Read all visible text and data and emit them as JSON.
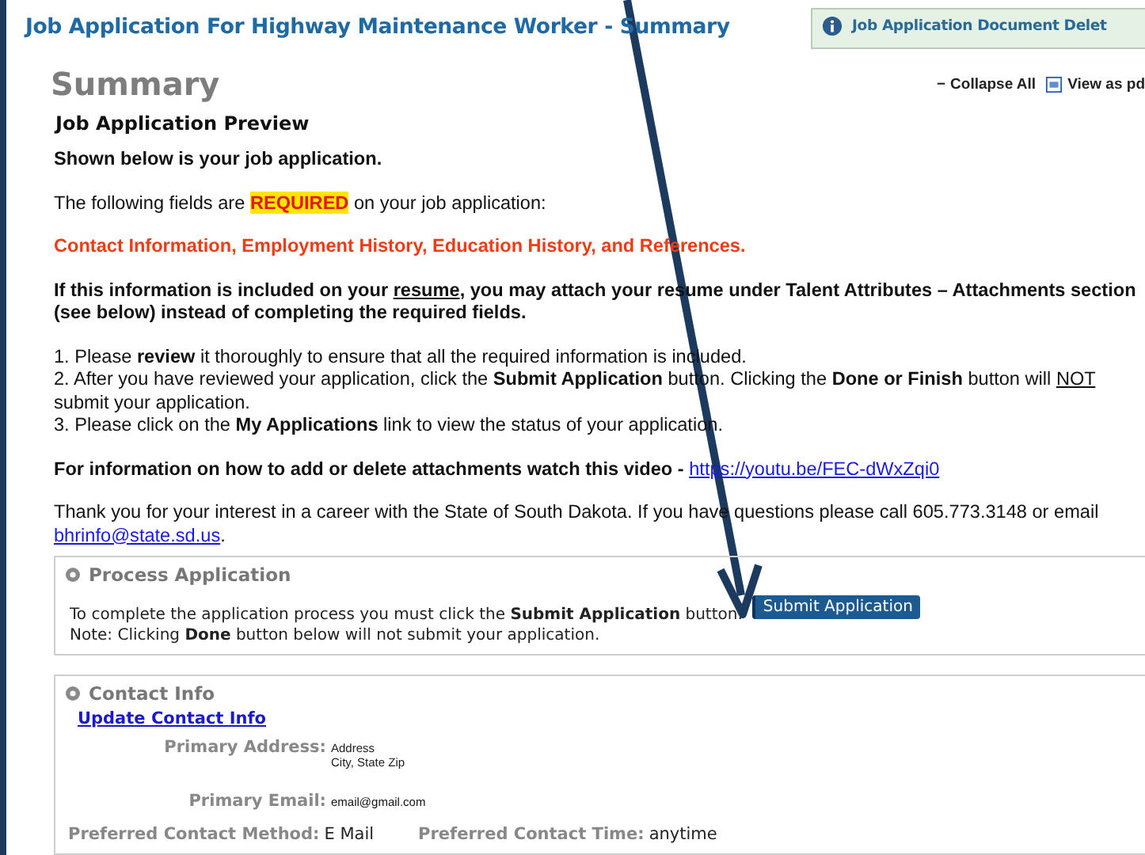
{
  "header": {
    "title": "Job Application For Highway Maintenance Worker - Summary",
    "notice": "Job Application Document Delet"
  },
  "summary": {
    "heading": "Summary",
    "actions": [
      {
        "kind": "collapse",
        "label": "Collapse All",
        "icon": "−"
      },
      {
        "kind": "pdf",
        "label": "View as pd"
      }
    ],
    "subheading": "Job Application Preview"
  },
  "paragraphs": [
    {
      "kind": "bold",
      "lines": [
        [
          {
            "kind": "plain",
            "text": "Shown below is your job application."
          }
        ]
      ]
    },
    {
      "kind": "normal",
      "lines": [
        [
          {
            "kind": "plain",
            "text": "The following fields are "
          },
          {
            "kind": "highlight",
            "text": "REQUIRED"
          },
          {
            "kind": "plain",
            "text": " on your job application:"
          }
        ]
      ]
    },
    {
      "kind": "alert",
      "lines": [
        [
          {
            "kind": "plain",
            "text": "Contact Information, Employment History, Education History, and References."
          }
        ]
      ]
    },
    {
      "kind": "bold",
      "lines": [
        [
          {
            "kind": "plain",
            "text": "If this information is included on your "
          },
          {
            "kind": "underline",
            "text": "resume"
          },
          {
            "kind": "plain",
            "text": ", you may attach your resume under Talent Attributes – Attachments section (see below) instead of completing the required fields."
          }
        ]
      ]
    },
    {
      "kind": "normal",
      "lines": [
        [
          {
            "kind": "plain",
            "text": "1. Please "
          },
          {
            "kind": "bold",
            "text": "review"
          },
          {
            "kind": "plain",
            "text": " it thoroughly to ensure that all the required information is included."
          }
        ],
        [
          {
            "kind": "plain",
            "text": "2. After you have reviewed your application, click the "
          },
          {
            "kind": "bold",
            "text": "Submit Application"
          },
          {
            "kind": "plain",
            "text": " button. Clicking the "
          },
          {
            "kind": "bold",
            "text": "Done or Finish"
          },
          {
            "kind": "plain",
            "text": " button will "
          },
          {
            "kind": "underline",
            "text": "NOT"
          },
          {
            "kind": "plain",
            "text": " submit your application."
          }
        ],
        [
          {
            "kind": "plain",
            "text": "3. Please click on the "
          },
          {
            "kind": "bold",
            "text": "My Applications"
          },
          {
            "kind": "plain",
            "text": " link to view the status of your application."
          }
        ]
      ]
    },
    {
      "kind": "bold",
      "lines": [
        [
          {
            "kind": "plain",
            "text": "For information on how to add or delete attachments watch this video - "
          },
          {
            "kind": "link",
            "text": "https://youtu.be/FEC-dWxZqi0"
          }
        ]
      ]
    },
    {
      "kind": "normal",
      "lines": [
        [
          {
            "kind": "plain",
            "text": "Thank you for your interest in a career with the State of South Dakota. If you have questions please call 605.773.3148 or email "
          },
          {
            "kind": "link",
            "text": "bhrinfo@state.sd.us"
          },
          {
            "kind": "plain",
            "text": "."
          }
        ]
      ]
    }
  ],
  "process": {
    "title": "Process Application",
    "line1": "To complete the application process you must click the **Submit Application** button.",
    "button": "Submit Application",
    "line2": "Note: Clicking **Done** button below will not submit your application."
  },
  "contact": {
    "title": "Contact Info",
    "link": "Update Contact Info",
    "address_label": "Primary Address:",
    "address_lines": [
      "Address",
      "City, State Zip"
    ],
    "email_label": "Primary Email:",
    "email": "email@gmail.com",
    "method_label": "Preferred Contact Method:",
    "method": "E Mail",
    "time_label": "Preferred Contact Time:",
    "time": "anytime"
  }
}
